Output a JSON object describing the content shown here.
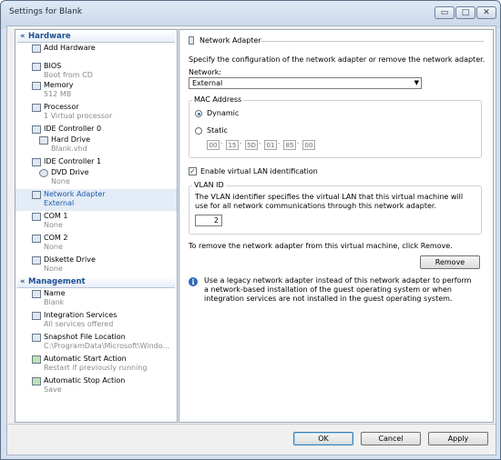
{
  "window": {
    "title": "Settings for Blank",
    "controls": {
      "minimize": "▭",
      "maximize": "□",
      "close": "✕"
    }
  },
  "sidebar": {
    "sections": [
      {
        "title": "Hardware",
        "icon": "collapse-chevron-icon"
      },
      {
        "title": "Management",
        "icon": "collapse-chevron-icon"
      }
    ],
    "hardware_items": [
      {
        "label": "Add Hardware",
        "sub": "",
        "icon": "add-hardware-icon"
      },
      {
        "label": "BIOS",
        "sub": "Boot from CD",
        "icon": "bios-icon"
      },
      {
        "label": "Memory",
        "sub": "512 MB",
        "icon": "memory-icon"
      },
      {
        "label": "Processor",
        "sub": "1 Virtual processor",
        "icon": "processor-icon"
      },
      {
        "label": "IDE Controller 0",
        "sub": "",
        "icon": "ide-controller-icon"
      },
      {
        "label": "Hard Drive",
        "sub": "Blank.vhd",
        "icon": "hard-drive-icon"
      },
      {
        "label": "IDE Controller 1",
        "sub": "",
        "icon": "ide-controller-icon"
      },
      {
        "label": "DVD Drive",
        "sub": "None",
        "icon": "dvd-drive-icon"
      },
      {
        "label": "Network Adapter",
        "sub": "External",
        "icon": "network-adapter-icon"
      },
      {
        "label": "COM 1",
        "sub": "None",
        "icon": "com-port-icon"
      },
      {
        "label": "COM 2",
        "sub": "None",
        "icon": "com-port-icon"
      },
      {
        "label": "Diskette Drive",
        "sub": "None",
        "icon": "diskette-drive-icon"
      }
    ],
    "management_items": [
      {
        "label": "Name",
        "sub": "Blank",
        "icon": "name-icon"
      },
      {
        "label": "Integration Services",
        "sub": "All services offered",
        "icon": "integration-services-icon"
      },
      {
        "label": "Snapshot File Location",
        "sub": "C:\\ProgramData\\Microsoft\\Windo...",
        "icon": "snapshot-folder-icon"
      },
      {
        "label": "Automatic Start Action",
        "sub": "Restart if previously running",
        "icon": "auto-start-icon"
      },
      {
        "label": "Automatic Stop Action",
        "sub": "Save",
        "icon": "auto-stop-icon"
      }
    ]
  },
  "panel": {
    "heading": "Network Adapter",
    "description": "Specify the configuration of the network adapter or remove the network adapter.",
    "network_label": "Network:",
    "network_value": "External",
    "mac_group_label": "MAC Address",
    "mac_dynamic_label": "Dynamic",
    "mac_static_label": "Static",
    "mac_selected": "Dynamic",
    "mac_octets": [
      "00",
      "15",
      "5D",
      "01",
      "85",
      "00"
    ],
    "vlan_checkbox_label": "Enable virtual LAN identification",
    "vlan_checked": true,
    "vlan_group_label": "VLAN ID",
    "vlan_description": "The VLAN identifier specifies the virtual LAN that this virtual machine will use for all network communications through this network adapter.",
    "vlan_id": "2",
    "remove_text": "To remove the network adapter from this virtual machine, click Remove.",
    "remove_button": "Remove",
    "info_text": "Use a legacy network adapter instead of this network adapter to perform a network-based installation of the guest operating system or when integration services are not installed in the guest operating system."
  },
  "footer": {
    "ok": "OK",
    "cancel": "Cancel",
    "apply": "Apply"
  }
}
